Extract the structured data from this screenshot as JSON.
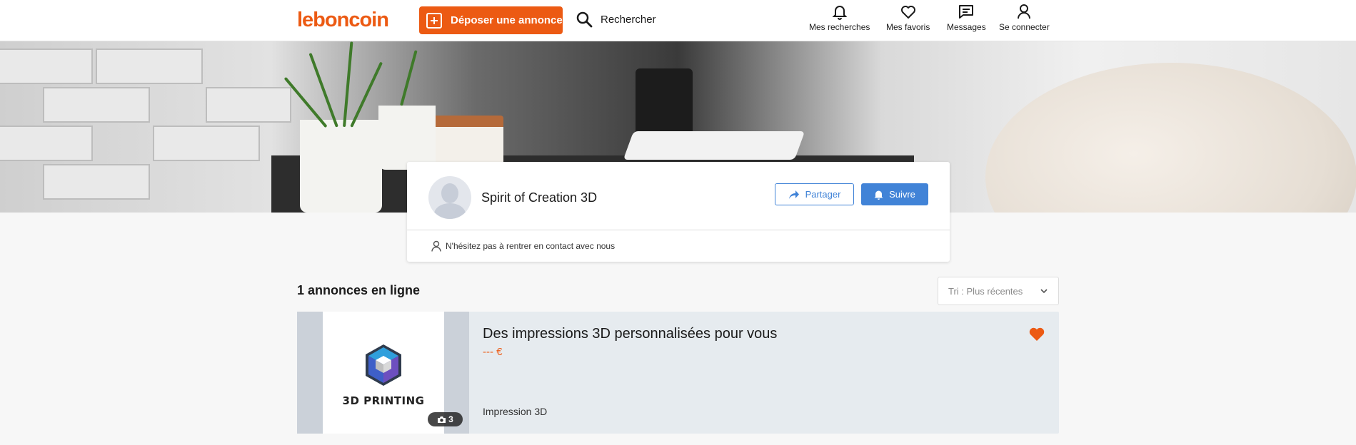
{
  "header": {
    "logo": "leboncoin",
    "post_label": "Déposer une annonce",
    "search_label": "Rechercher",
    "nav": [
      {
        "label": "Mes recherches",
        "icon": "bell-icon"
      },
      {
        "label": "Mes favoris",
        "icon": "heart-icon"
      },
      {
        "label": "Messages",
        "icon": "message-icon"
      },
      {
        "label": "Se connecter",
        "icon": "user-icon"
      }
    ],
    "brand_color": "#ec5a13"
  },
  "profile": {
    "name": "Spirit of Creation 3D",
    "share_label": "Partager",
    "follow_label": "Suivre",
    "note": "N'hésitez pas à rentrer en contact avec nous",
    "accent_color": "#4183d7"
  },
  "listings_header": {
    "count_title": "1 annonces en ligne",
    "sort_label": "Tri : Plus récentes"
  },
  "listings": [
    {
      "title": "Des impressions 3D personnalisées pour vous",
      "price": "--- €",
      "category": "Impression 3D",
      "photo_count": "3",
      "image_label": "3D PRINTING",
      "favorite": true
    }
  ]
}
